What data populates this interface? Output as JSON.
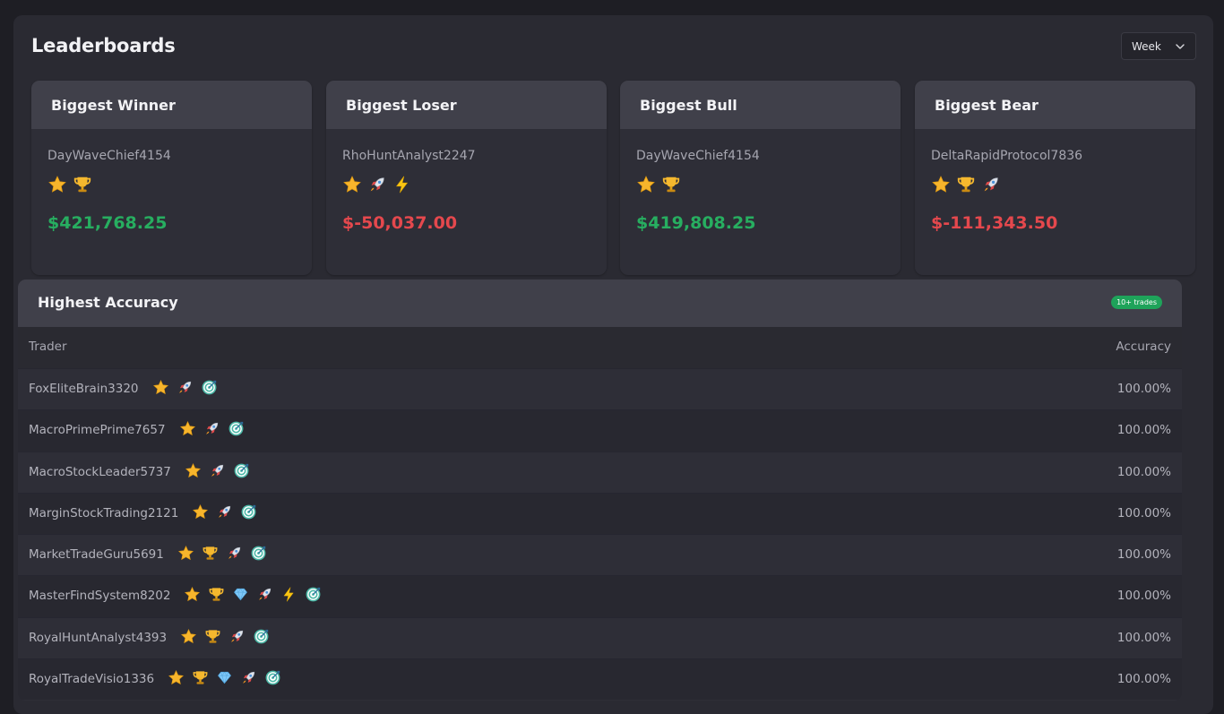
{
  "page": {
    "title": "Leaderboards",
    "period_select": {
      "value": "Week"
    }
  },
  "cards": [
    {
      "heading": "Biggest Winner",
      "trader": "DayWaveChief4154",
      "badges": [
        "star-icon",
        "trophy-icon"
      ],
      "value": "$421,768.25",
      "tone": "positive"
    },
    {
      "heading": "Biggest Loser",
      "trader": "RhoHuntAnalyst2247",
      "badges": [
        "star-icon",
        "rocket-icon",
        "lightning-icon"
      ],
      "value": "$-50,037.00",
      "tone": "negative"
    },
    {
      "heading": "Biggest Bull",
      "trader": "DayWaveChief4154",
      "badges": [
        "star-icon",
        "trophy-icon"
      ],
      "value": "$419,808.25",
      "tone": "positive"
    },
    {
      "heading": "Biggest Bear",
      "trader": "DeltaRapidProtocol7836",
      "badges": [
        "star-icon",
        "trophy-icon",
        "rocket-icon"
      ],
      "value": "$-111,343.50",
      "tone": "negative"
    }
  ],
  "accuracy": {
    "heading": "Highest Accuracy",
    "badge": "10+ trades",
    "columns": {
      "trader": "Trader",
      "accuracy": "Accuracy"
    },
    "rows": [
      {
        "trader": "FoxEliteBrain3320",
        "badges": [
          "star-icon",
          "rocket-icon",
          "target-icon"
        ],
        "accuracy": "100.00%"
      },
      {
        "trader": "MacroPrimePrime7657",
        "badges": [
          "star-icon",
          "rocket-icon",
          "target-icon"
        ],
        "accuracy": "100.00%"
      },
      {
        "trader": "MacroStockLeader5737",
        "badges": [
          "star-icon",
          "rocket-icon",
          "target-icon"
        ],
        "accuracy": "100.00%"
      },
      {
        "trader": "MarginStockTrading2121",
        "badges": [
          "star-icon",
          "rocket-icon",
          "target-icon"
        ],
        "accuracy": "100.00%"
      },
      {
        "trader": "MarketTradeGuru5691",
        "badges": [
          "star-icon",
          "trophy-icon",
          "rocket-icon",
          "target-icon"
        ],
        "accuracy": "100.00%"
      },
      {
        "trader": "MasterFindSystem8202",
        "badges": [
          "star-icon",
          "trophy-icon",
          "diamond-icon",
          "rocket-icon",
          "lightning-icon",
          "target-icon"
        ],
        "accuracy": "100.00%"
      },
      {
        "trader": "RoyalHuntAnalyst4393",
        "badges": [
          "star-icon",
          "trophy-icon",
          "rocket-icon",
          "target-icon"
        ],
        "accuracy": "100.00%"
      },
      {
        "trader": "RoyalTradeVisio1336",
        "badges": [
          "star-icon",
          "trophy-icon",
          "diamond-icon",
          "rocket-icon",
          "target-icon"
        ],
        "accuracy": "100.00%"
      }
    ]
  },
  "colors": {
    "background": "#1e1e24",
    "panel": "#2a2a32",
    "card_header": "#40404a",
    "positive": "#27ae60",
    "negative": "#e5484d",
    "pill": "#1ea35a"
  }
}
